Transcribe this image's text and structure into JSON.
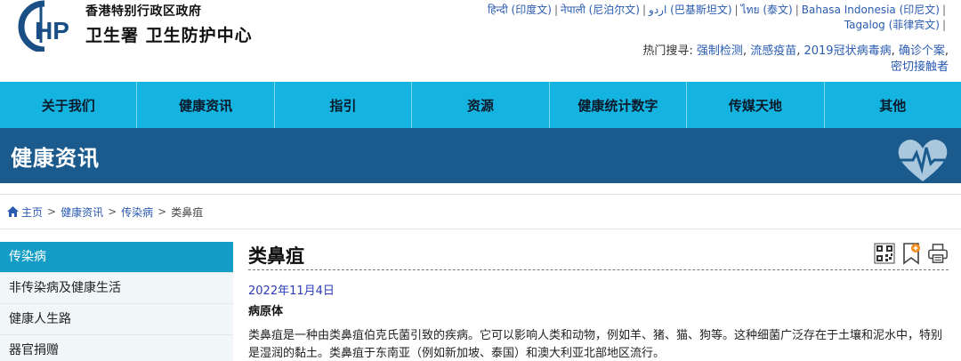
{
  "header": {
    "gov_name": "香港特别行政区政府",
    "dept_name": "卫生署  卫生防护中心",
    "languages": [
      {
        "label": "हिन्दी (印度文)"
      },
      {
        "label": "नेपाली (尼泊尔文)"
      },
      {
        "label": "اردو (巴基斯坦文)"
      },
      {
        "label": "ไทย (泰文)"
      },
      {
        "label": "Bahasa Indonesia (印尼文)"
      },
      {
        "label": "Tagalog (菲律宾文)"
      }
    ],
    "hot_search": {
      "label": "热门搜寻:",
      "items": [
        "强制检测",
        "流感疫苗",
        "2019冠状病毒病",
        "确诊个案",
        "密切接触者"
      ]
    }
  },
  "nav": {
    "items": [
      "关于我们",
      "健康资讯",
      "指引",
      "资源",
      "健康统计数字",
      "传媒天地",
      "其他"
    ]
  },
  "banner": {
    "title": "健康资讯",
    "icon": "heart-pulse-icon"
  },
  "breadcrumb": {
    "items": [
      "主页",
      "健康资讯",
      "传染病",
      "类鼻疽"
    ]
  },
  "sidebar": {
    "items": [
      {
        "label": "传染病",
        "active": true
      },
      {
        "label": "非传染病及健康生活",
        "active": false
      },
      {
        "label": "健康人生路",
        "active": false
      },
      {
        "label": "器官捐赠",
        "active": false
      }
    ]
  },
  "content": {
    "title": "类鼻疽",
    "date": "2022年11月4日",
    "section": "病原体",
    "paragraph": "类鼻疽是一种由类鼻疽伯克氏菌引致的疾病。它可以影响人类和动物，例如羊、猪、猫、狗等。这种细菌广泛存在于土壤和泥水中，特别是湿润的黏土。类鼻疽于东南亚（例如新加坡、泰国）和澳大利亚北部地区流行。"
  },
  "colors": {
    "nav_bg": "#14b3e0",
    "banner_bg": "#1a5a8c",
    "sidebar_active": "#139dc6",
    "link": "#2a5bb0"
  }
}
